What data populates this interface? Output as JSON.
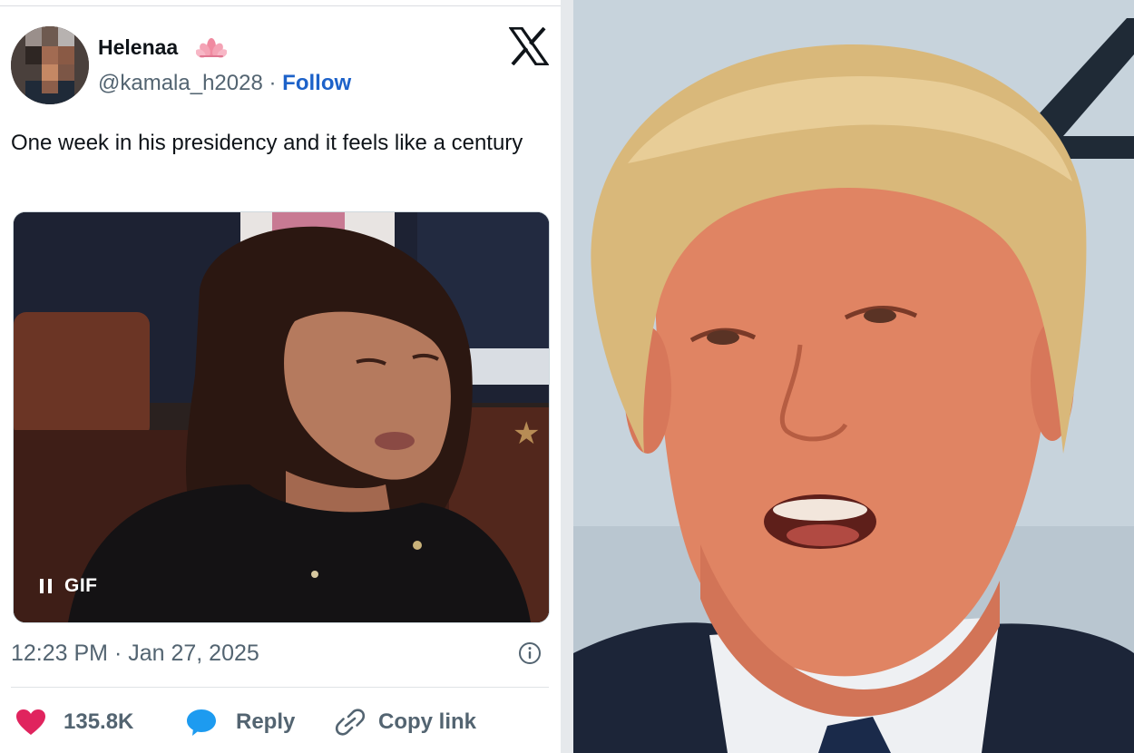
{
  "tweet": {
    "display_name": "Helenaa",
    "handle": "@kamala_h2028",
    "separator": "·",
    "follow_label": "Follow",
    "text": "One week in his presidency and it feels like a century",
    "media": {
      "badge_label": "GIF",
      "pause_icon": "pause-icon"
    },
    "timestamp": "12:23 PM · Jan 27, 2025",
    "icons": [
      "lotus-icon",
      "x-logo-icon",
      "info-icon",
      "heart-icon",
      "reply-bubble-icon",
      "link-icon"
    ],
    "actions": {
      "like_count": "135.8K",
      "reply_label": "Reply",
      "copy_link_label": "Copy link"
    },
    "colors": {
      "like": "#e0245e",
      "reply": "#1d9bf0",
      "follow": "#1d62c9",
      "muted_text": "#536471",
      "text": "#0f1419"
    }
  }
}
